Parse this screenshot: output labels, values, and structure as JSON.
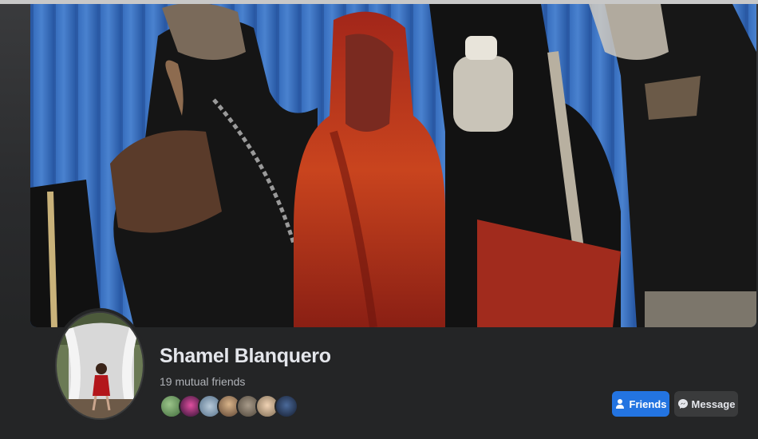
{
  "profile": {
    "name": "Shamel Blanquero",
    "mutual_friends": "19 mutual friends"
  },
  "actions": {
    "friends_label": "Friends",
    "message_label": "Message"
  },
  "colors": {
    "background": "#242526",
    "primary_button": "#2374e1",
    "secondary_button": "#3a3b3c",
    "text_primary": "#e4e6eb",
    "text_secondary": "#b0b3b8"
  },
  "icons": {
    "friends": "person-check-icon",
    "message": "messenger-icon"
  }
}
